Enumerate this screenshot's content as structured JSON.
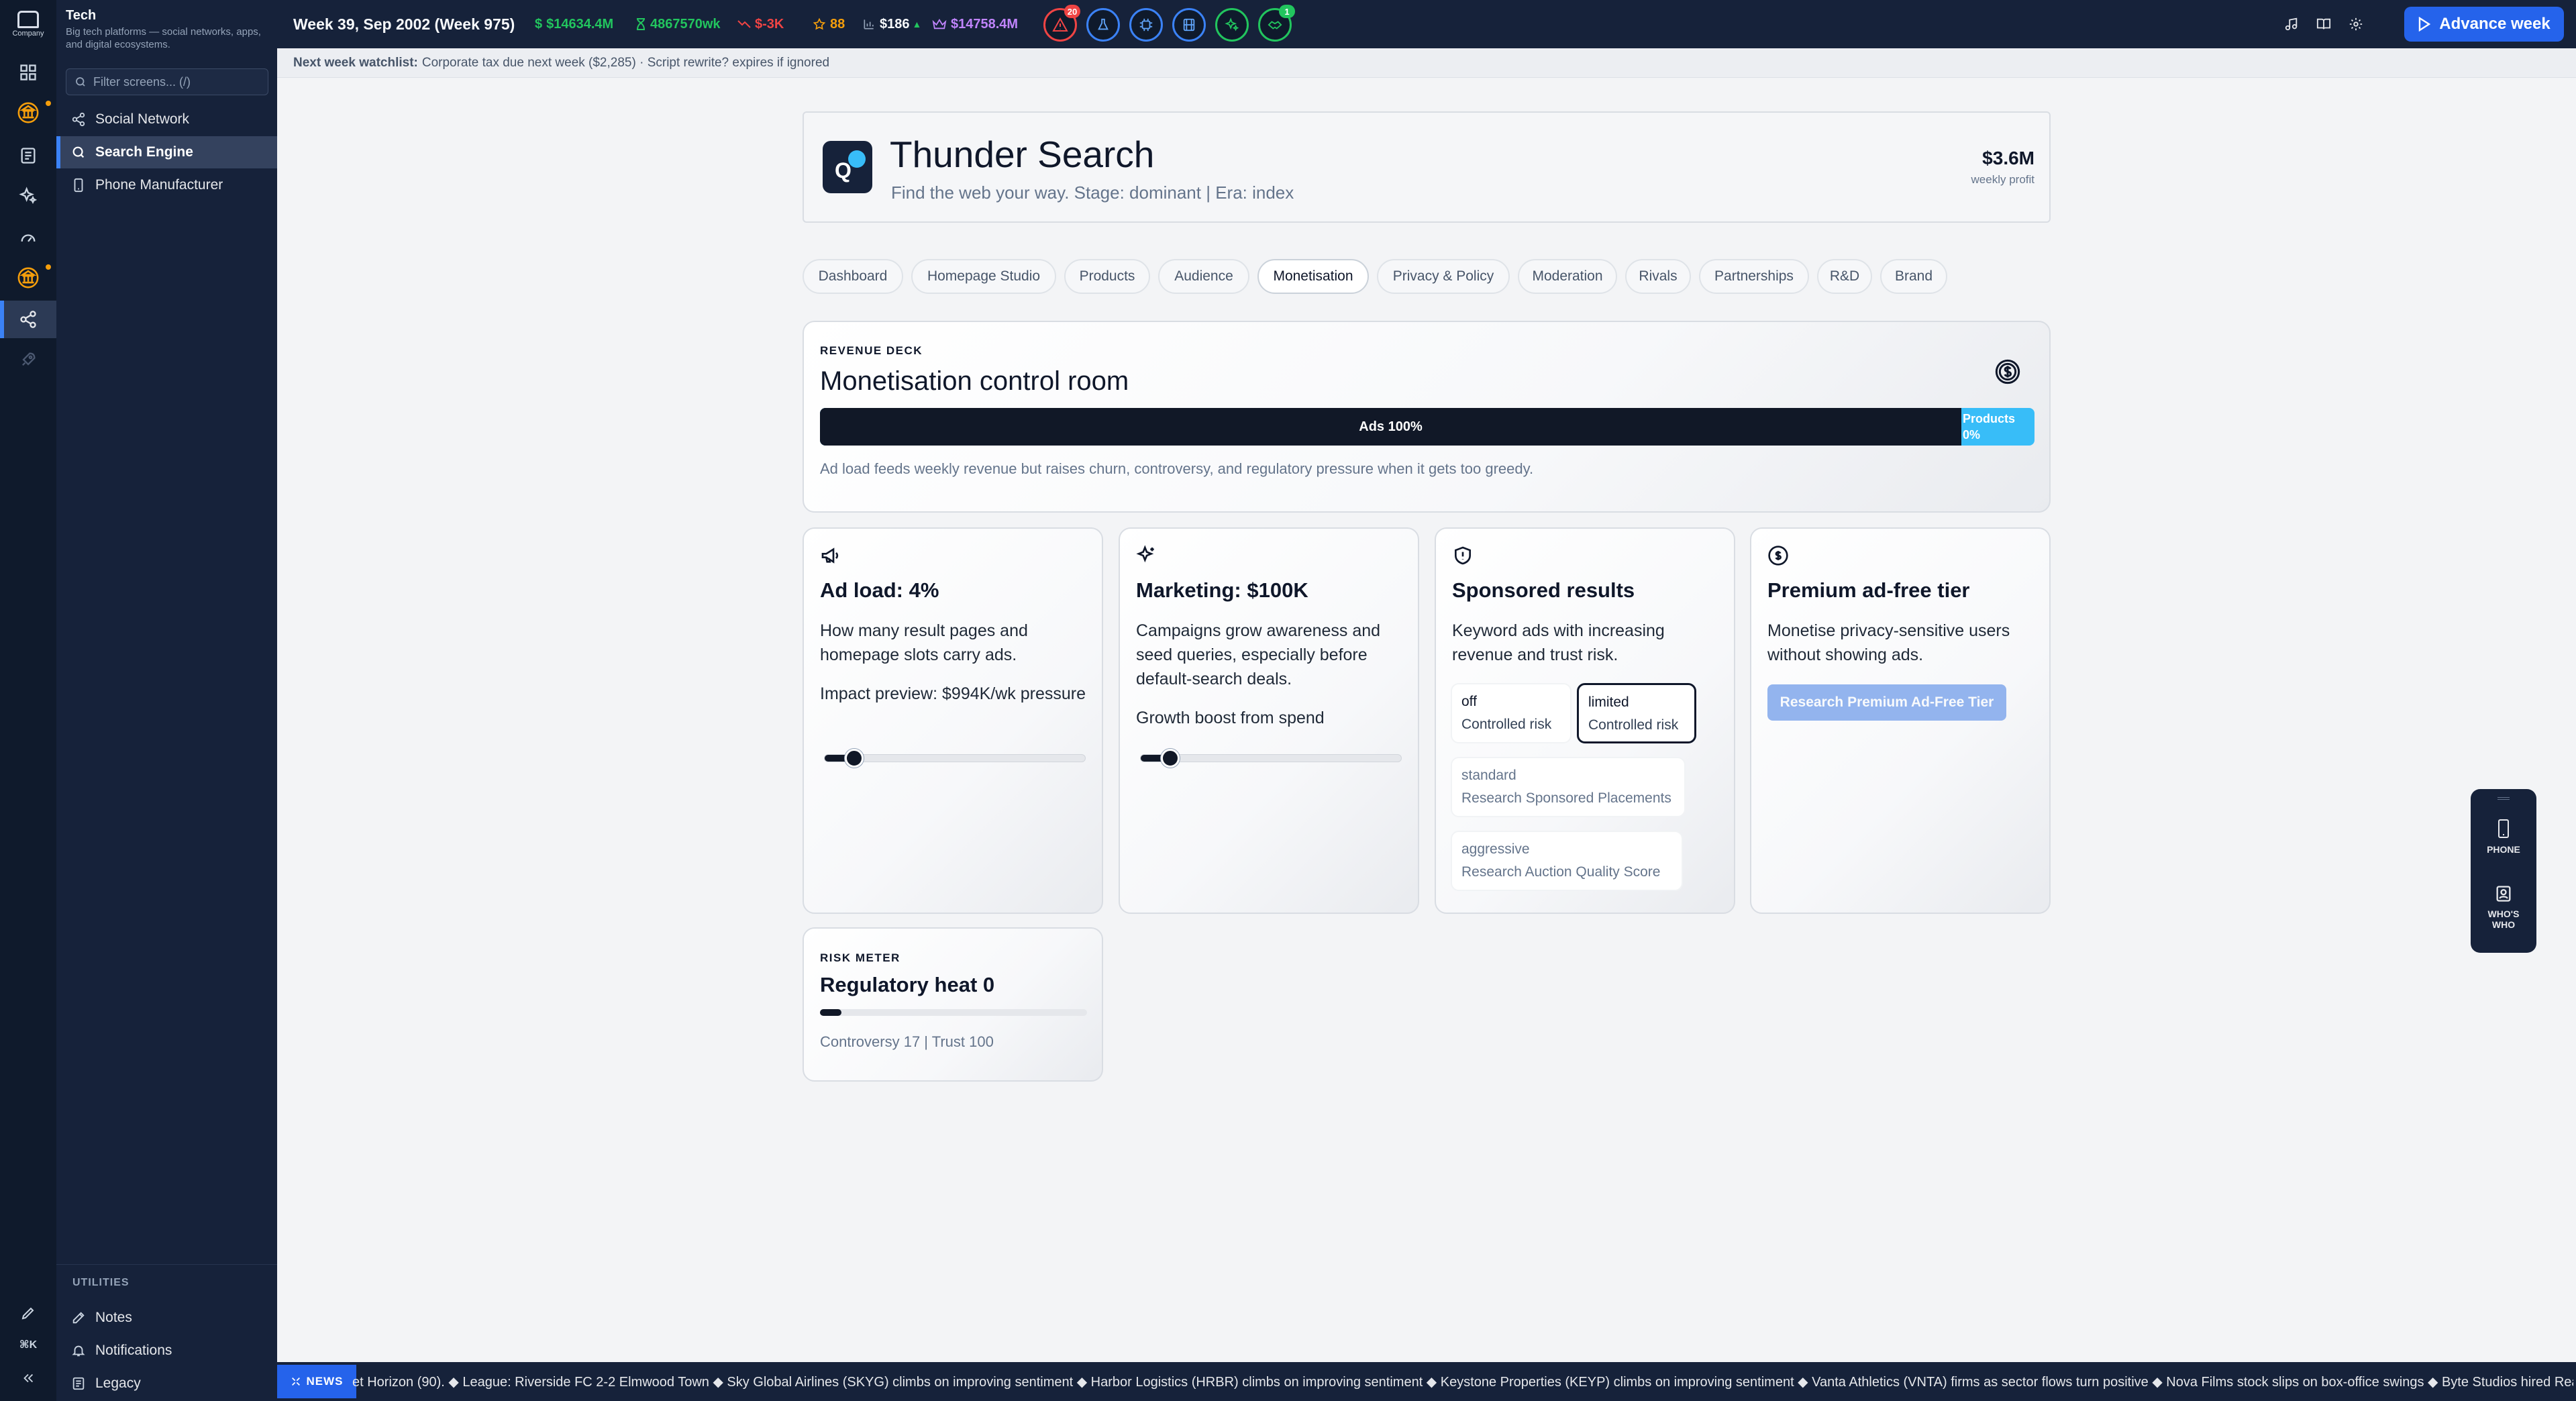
{
  "app": {
    "logo_text": "Company",
    "section_title": "Tech",
    "section_subtitle": "Big tech platforms — social networks, apps, and digital ecosystems.",
    "search_placeholder": "Filter screens... (/)"
  },
  "sidebar": {
    "items": [
      {
        "label": "Social Network",
        "icon": "share-icon"
      },
      {
        "label": "Search Engine",
        "icon": "search-icon",
        "active": true
      },
      {
        "label": "Phone Manufacturer",
        "icon": "phone-icon"
      }
    ],
    "utilities_label": "UTILITIES",
    "utilities": [
      {
        "label": "Notes",
        "icon": "notes-icon"
      },
      {
        "label": "Notifications",
        "icon": "bell-icon"
      },
      {
        "label": "Legacy",
        "icon": "legacy-icon"
      }
    ],
    "shortcut_label": "⌘K"
  },
  "topbar": {
    "week": "Week 39, Sep 2002 (Week 975)",
    "cash": "$14634.4M",
    "per_week": "4867570wk",
    "delta": "$-3K",
    "stars": "88",
    "stock": "$186",
    "net_worth": "$14758.4M",
    "alerts_badge": "20",
    "green_badge": "1",
    "advance_label": "Advance week",
    "colors": {
      "cash": "#22c55e",
      "delta": "#ef4444",
      "stars": "#f59e0b",
      "networth": "#c084fc"
    }
  },
  "watchlist": {
    "label": "Next week watchlist:",
    "text": "Corporate tax due next week ($2,285) · Script rewrite? expires if ignored"
  },
  "company": {
    "name": "Thunder Search",
    "logo_letter": "Q",
    "tagline": "Find the web your way. Stage: dominant | Era: index",
    "profit": "$3.6M",
    "profit_label": "weekly profit"
  },
  "tabs": [
    "Dashboard",
    "Homepage Studio",
    "Products",
    "Audience",
    "Monetisation",
    "Privacy & Policy",
    "Moderation",
    "Rivals",
    "Partnerships",
    "R&D",
    "Brand"
  ],
  "active_tab": "Monetisation",
  "deck": {
    "kicker": "REVENUE DECK",
    "title": "Monetisation control room",
    "ads_label": "Ads 100%",
    "products_label_1": "Products",
    "products_label_2": "0%",
    "ads_share": 0.94,
    "note": "Ad load feeds weekly revenue but raises churn, controversy, and regulatory pressure when it gets too greedy."
  },
  "cards": {
    "adload": {
      "title": "Ad load: 4%",
      "desc": "How many result pages and homepage slots carry ads.",
      "impact": "Impact preview: $994K/wk pressure",
      "level": 0.04
    },
    "marketing": {
      "title": "Marketing: $100K",
      "desc": "Campaigns grow awareness and seed queries, especially before default-search deals.",
      "boost": "Growth boost from spend",
      "level": 0.04
    },
    "sponsored": {
      "title": "Sponsored results",
      "desc": "Keyword ads with increasing revenue and trust risk.",
      "options": [
        {
          "name": "off",
          "sub": "Controlled risk"
        },
        {
          "name": "limited",
          "sub": "Controlled risk"
        },
        {
          "name": "standard",
          "sub": "Research Sponsored Placements"
        },
        {
          "name": "aggressive",
          "sub": "Research Auction Quality Score"
        }
      ],
      "selected": "limited"
    },
    "premium": {
      "title": "Premium ad-free tier",
      "desc": "Monetise privacy-sensitive users without showing ads.",
      "button": "Research Premium Ad-Free Tier"
    }
  },
  "risk": {
    "kicker": "RISK METER",
    "title": "Regulatory heat 0",
    "note": "Controversy 17 | Trust 100",
    "level": 0.05
  },
  "dock": {
    "phone": "PHONE",
    "whos_who_1": "WHO'S",
    "whos_who_2": "WHO"
  },
  "news": {
    "tag": "NEWS",
    "ticker": "et Horizon (90). ◆ League: Riverside FC 2-2 Elmwood Town ◆ Sky Global Airlines (SKYG) climbs on improving sentiment ◆ Harbor Logistics (HRBR) climbs on improving sentiment ◆ Keystone Properties (KEYP) climbs on improving sentiment ◆ Vanta Athletics (VNTA) firms as sector flows turn positive ◆ Nova Films stock slips on box-office swings ◆ Byte Studios hired Reagan (artis"
  }
}
